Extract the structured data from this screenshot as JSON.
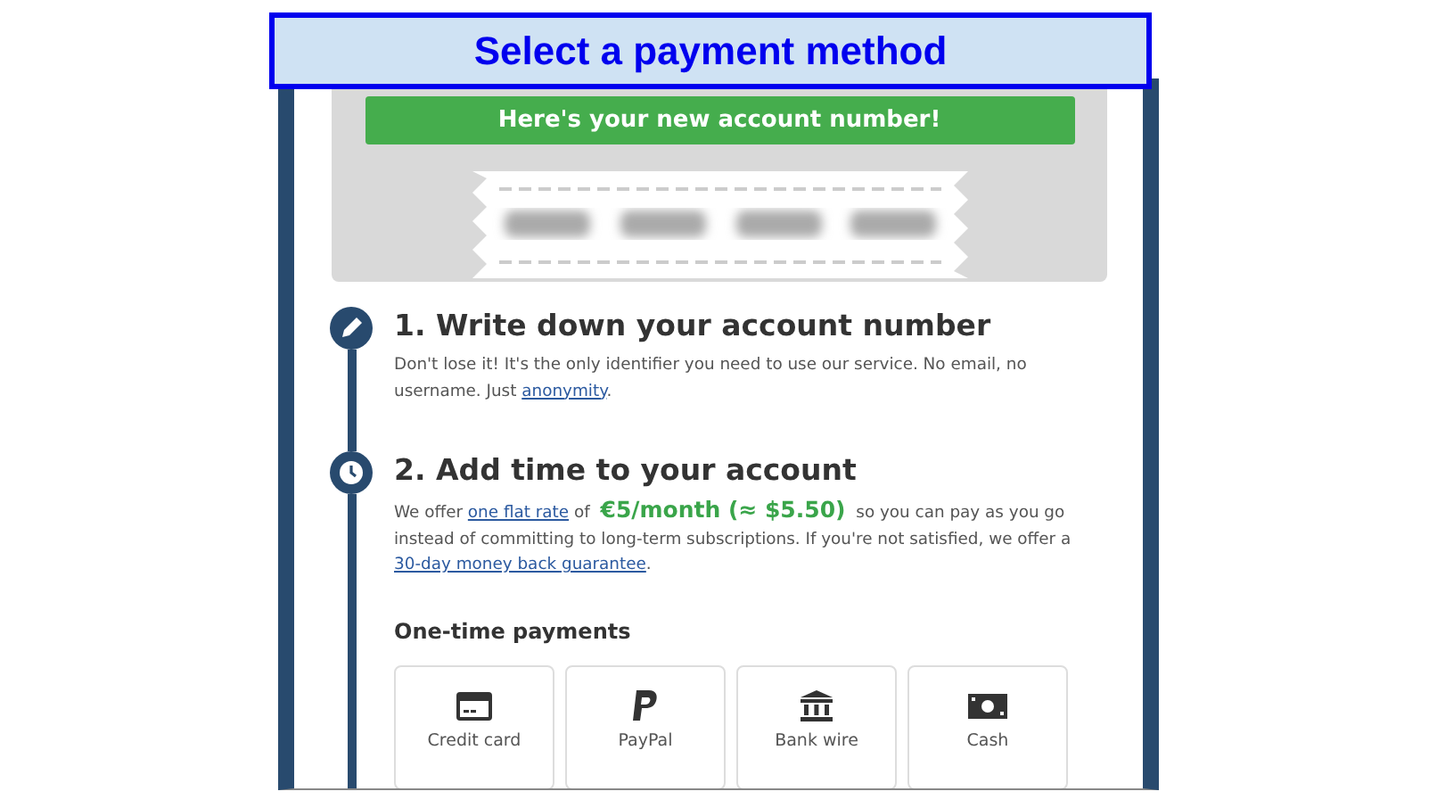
{
  "banner": {
    "title": "Select a payment method"
  },
  "account_box": {
    "heading": "Here's your new account number!"
  },
  "steps": [
    {
      "kind": "pencil",
      "title": "1. Write down your account number",
      "text": [
        {
          "kind": "plain",
          "text": "Don't lose it! It's the only identifier you need to use our service. No email, no username. Just "
        },
        {
          "kind": "link",
          "text": "anonymity"
        },
        {
          "kind": "plain",
          "text": "."
        }
      ]
    },
    {
      "kind": "clock",
      "title": "2. Add time to your account",
      "text": [
        {
          "kind": "plain",
          "text": "We offer "
        },
        {
          "kind": "link",
          "text": "one flat rate"
        },
        {
          "kind": "plain",
          "text": " of "
        },
        {
          "kind": "price",
          "text": "€5/month (≈ $5.50)"
        },
        {
          "kind": "plain",
          "text": " so you can pay as you go instead of committing to long-term subscriptions. If you're not satisfied, we offer a "
        },
        {
          "kind": "link",
          "text": "30-day money back guarantee"
        },
        {
          "kind": "plain",
          "text": "."
        }
      ]
    }
  ],
  "payments": {
    "heading": "One-time payments",
    "methods": [
      {
        "kind": "card",
        "label": "Credit card"
      },
      {
        "kind": "paypal",
        "label": "PayPal"
      },
      {
        "kind": "bank",
        "label": "Bank wire"
      },
      {
        "kind": "cash",
        "label": "Cash"
      }
    ]
  }
}
